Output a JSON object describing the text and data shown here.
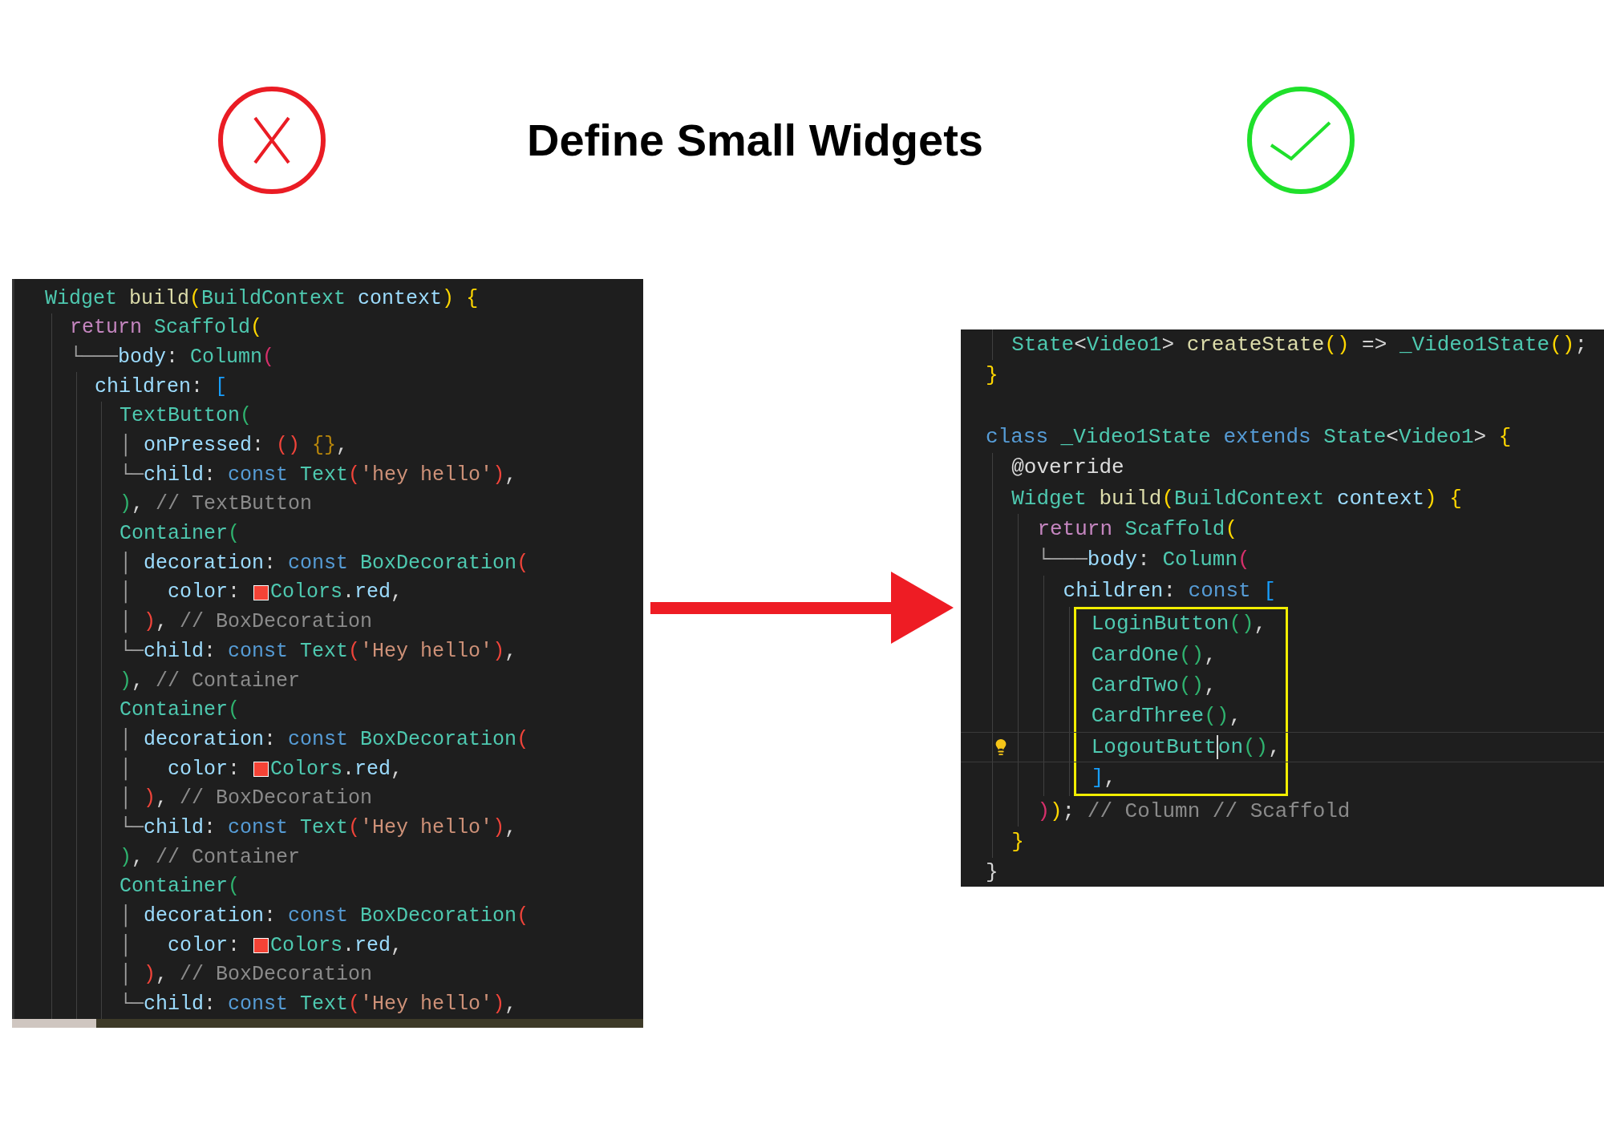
{
  "header": {
    "title": "Define Small Widgets"
  },
  "before_code": {
    "lines": [
      {
        "tokens": [
          {
            "kind": "type",
            "text": "Widget"
          },
          {
            "kind": "function",
            "text": " build"
          },
          {
            "kind": "b-gold",
            "text": "("
          },
          {
            "kind": "type",
            "text": "BuildContext"
          },
          {
            "kind": "variable",
            "text": " context"
          },
          {
            "kind": "b-gold",
            "text": ")"
          },
          {
            "kind": "b-gold",
            "text": " {"
          }
        ],
        "children": [
          {
            "tokens": [
              {
                "kind": "control",
                "text": "return"
              },
              {
                "kind": "type",
                "text": " Scaffold"
              },
              {
                "kind": "b-gold",
                "text": "("
              }
            ]
          },
          {
            "tokens": [
              {
                "kind": "guide",
                "text": "└───"
              },
              {
                "kind": "variable",
                "text": "body"
              },
              {
                "kind": "punct",
                "text": ": "
              },
              {
                "kind": "type",
                "text": "Column"
              },
              {
                "kind": "b-pink",
                "text": "("
              }
            ],
            "children": [
              {
                "tokens": [
                  {
                    "kind": "variable",
                    "text": "children"
                  },
                  {
                    "kind": "punct",
                    "text": ": "
                  },
                  {
                    "kind": "b-blue",
                    "text": "["
                  }
                ],
                "children": [
                  {
                    "tokens": [
                      {
                        "kind": "type",
                        "text": "TextButton"
                      },
                      {
                        "kind": "b-green",
                        "text": "("
                      }
                    ]
                  },
                  {
                    "tokens": [
                      {
                        "kind": "guide",
                        "text": "│ "
                      },
                      {
                        "kind": "variable",
                        "text": "onPressed"
                      },
                      {
                        "kind": "punct",
                        "text": ": "
                      },
                      {
                        "kind": "b-red",
                        "text": "()"
                      },
                      {
                        "kind": "b-brown",
                        "text": " {}"
                      },
                      {
                        "kind": "punct",
                        "text": ","
                      }
                    ]
                  },
                  {
                    "tokens": [
                      {
                        "kind": "guide",
                        "text": "└─"
                      },
                      {
                        "kind": "variable",
                        "text": "child"
                      },
                      {
                        "kind": "punct",
                        "text": ": "
                      },
                      {
                        "kind": "keyword",
                        "text": "const"
                      },
                      {
                        "kind": "type",
                        "text": " Text"
                      },
                      {
                        "kind": "b-red",
                        "text": "("
                      },
                      {
                        "kind": "string",
                        "text": "'hey hello'"
                      },
                      {
                        "kind": "b-red",
                        "text": ")"
                      },
                      {
                        "kind": "punct",
                        "text": ","
                      }
                    ]
                  },
                  {
                    "tokens": [
                      {
                        "kind": "b-green",
                        "text": ")"
                      },
                      {
                        "kind": "punct",
                        "text": ","
                      },
                      {
                        "kind": "comment",
                        "text": " // TextButton"
                      }
                    ]
                  },
                  {
                    "tokens": [
                      {
                        "kind": "type",
                        "text": "Container"
                      },
                      {
                        "kind": "b-green",
                        "text": "("
                      }
                    ]
                  },
                  {
                    "tokens": [
                      {
                        "kind": "guide",
                        "text": "│ "
                      },
                      {
                        "kind": "variable",
                        "text": "decoration"
                      },
                      {
                        "kind": "punct",
                        "text": ": "
                      },
                      {
                        "kind": "keyword",
                        "text": "const"
                      },
                      {
                        "kind": "type",
                        "text": " BoxDecoration"
                      },
                      {
                        "kind": "b-red",
                        "text": "("
                      }
                    ]
                  },
                  {
                    "tokens": [
                      {
                        "kind": "guide",
                        "text": "│   "
                      },
                      {
                        "kind": "variable",
                        "text": "color"
                      },
                      {
                        "kind": "punct",
                        "text": ": "
                      },
                      {
                        "kind": "swatch",
                        "color": "#f44336"
                      },
                      {
                        "kind": "type",
                        "text": "Colors"
                      },
                      {
                        "kind": "punct",
                        "text": "."
                      },
                      {
                        "kind": "variable",
                        "text": "red"
                      },
                      {
                        "kind": "punct",
                        "text": ","
                      }
                    ]
                  },
                  {
                    "tokens": [
                      {
                        "kind": "guide",
                        "text": "│ "
                      },
                      {
                        "kind": "b-red",
                        "text": ")"
                      },
                      {
                        "kind": "punct",
                        "text": ","
                      },
                      {
                        "kind": "comment",
                        "text": " // BoxDecoration"
                      }
                    ]
                  },
                  {
                    "tokens": [
                      {
                        "kind": "guide",
                        "text": "└─"
                      },
                      {
                        "kind": "variable",
                        "text": "child"
                      },
                      {
                        "kind": "punct",
                        "text": ": "
                      },
                      {
                        "kind": "keyword",
                        "text": "const"
                      },
                      {
                        "kind": "type",
                        "text": " Text"
                      },
                      {
                        "kind": "b-red",
                        "text": "("
                      },
                      {
                        "kind": "string",
                        "text": "'Hey hello'"
                      },
                      {
                        "kind": "b-red",
                        "text": ")"
                      },
                      {
                        "kind": "punct",
                        "text": ","
                      }
                    ]
                  },
                  {
                    "tokens": [
                      {
                        "kind": "b-green",
                        "text": ")"
                      },
                      {
                        "kind": "punct",
                        "text": ","
                      },
                      {
                        "kind": "comment",
                        "text": " // Container"
                      }
                    ]
                  },
                  {
                    "tokens": [
                      {
                        "kind": "type",
                        "text": "Container"
                      },
                      {
                        "kind": "b-green",
                        "text": "("
                      }
                    ]
                  },
                  {
                    "tokens": [
                      {
                        "kind": "guide",
                        "text": "│ "
                      },
                      {
                        "kind": "variable",
                        "text": "decoration"
                      },
                      {
                        "kind": "punct",
                        "text": ": "
                      },
                      {
                        "kind": "keyword",
                        "text": "const"
                      },
                      {
                        "kind": "type",
                        "text": " BoxDecoration"
                      },
                      {
                        "kind": "b-red",
                        "text": "("
                      }
                    ]
                  },
                  {
                    "tokens": [
                      {
                        "kind": "guide",
                        "text": "│   "
                      },
                      {
                        "kind": "variable",
                        "text": "color"
                      },
                      {
                        "kind": "punct",
                        "text": ": "
                      },
                      {
                        "kind": "swatch",
                        "color": "#f44336"
                      },
                      {
                        "kind": "type",
                        "text": "Colors"
                      },
                      {
                        "kind": "punct",
                        "text": "."
                      },
                      {
                        "kind": "variable",
                        "text": "red"
                      },
                      {
                        "kind": "punct",
                        "text": ","
                      }
                    ]
                  },
                  {
                    "tokens": [
                      {
                        "kind": "guide",
                        "text": "│ "
                      },
                      {
                        "kind": "b-red",
                        "text": ")"
                      },
                      {
                        "kind": "punct",
                        "text": ","
                      },
                      {
                        "kind": "comment",
                        "text": " // BoxDecoration"
                      }
                    ]
                  },
                  {
                    "tokens": [
                      {
                        "kind": "guide",
                        "text": "└─"
                      },
                      {
                        "kind": "variable",
                        "text": "child"
                      },
                      {
                        "kind": "punct",
                        "text": ": "
                      },
                      {
                        "kind": "keyword",
                        "text": "const"
                      },
                      {
                        "kind": "type",
                        "text": " Text"
                      },
                      {
                        "kind": "b-red",
                        "text": "("
                      },
                      {
                        "kind": "string",
                        "text": "'Hey hello'"
                      },
                      {
                        "kind": "b-red",
                        "text": ")"
                      },
                      {
                        "kind": "punct",
                        "text": ","
                      }
                    ]
                  },
                  {
                    "tokens": [
                      {
                        "kind": "b-green",
                        "text": ")"
                      },
                      {
                        "kind": "punct",
                        "text": ","
                      },
                      {
                        "kind": "comment",
                        "text": " // Container"
                      }
                    ]
                  },
                  {
                    "tokens": [
                      {
                        "kind": "type",
                        "text": "Container"
                      },
                      {
                        "kind": "b-green",
                        "text": "("
                      }
                    ]
                  },
                  {
                    "tokens": [
                      {
                        "kind": "guide",
                        "text": "│ "
                      },
                      {
                        "kind": "variable",
                        "text": "decoration"
                      },
                      {
                        "kind": "punct",
                        "text": ": "
                      },
                      {
                        "kind": "keyword",
                        "text": "const"
                      },
                      {
                        "kind": "type",
                        "text": " BoxDecoration"
                      },
                      {
                        "kind": "b-red",
                        "text": "("
                      }
                    ]
                  },
                  {
                    "tokens": [
                      {
                        "kind": "guide",
                        "text": "│   "
                      },
                      {
                        "kind": "variable",
                        "text": "color"
                      },
                      {
                        "kind": "punct",
                        "text": ": "
                      },
                      {
                        "kind": "swatch",
                        "color": "#f44336"
                      },
                      {
                        "kind": "type",
                        "text": "Colors"
                      },
                      {
                        "kind": "punct",
                        "text": "."
                      },
                      {
                        "kind": "variable",
                        "text": "red"
                      },
                      {
                        "kind": "punct",
                        "text": ","
                      }
                    ]
                  },
                  {
                    "tokens": [
                      {
                        "kind": "guide",
                        "text": "│ "
                      },
                      {
                        "kind": "b-red",
                        "text": ")"
                      },
                      {
                        "kind": "punct",
                        "text": ","
                      },
                      {
                        "kind": "comment",
                        "text": " // BoxDecoration"
                      }
                    ]
                  },
                  {
                    "tokens": [
                      {
                        "kind": "guide",
                        "text": "└─"
                      },
                      {
                        "kind": "variable",
                        "text": "child"
                      },
                      {
                        "kind": "punct",
                        "text": ": "
                      },
                      {
                        "kind": "keyword",
                        "text": "const"
                      },
                      {
                        "kind": "type",
                        "text": " Text"
                      },
                      {
                        "kind": "b-red",
                        "text": "("
                      },
                      {
                        "kind": "string",
                        "text": "'Hey hello'"
                      },
                      {
                        "kind": "b-red",
                        "text": ")"
                      },
                      {
                        "kind": "punct",
                        "text": ","
                      }
                    ]
                  }
                ]
              }
            ]
          }
        ]
      }
    ]
  },
  "after_code": {
    "lines": [
      {
        "children": [
          {
            "tokens": [
              {
                "kind": "type",
                "text": "State"
              },
              {
                "kind": "punct",
                "text": "<"
              },
              {
                "kind": "type",
                "text": "Video1"
              },
              {
                "kind": "punct",
                "text": ">"
              },
              {
                "kind": "function",
                "text": " createState"
              },
              {
                "kind": "b-gold",
                "text": "()"
              },
              {
                "kind": "punct",
                "text": " =>"
              },
              {
                "kind": "type",
                "text": " _Video1State"
              },
              {
                "kind": "b-gold",
                "text": "()"
              },
              {
                "kind": "punct",
                "text": ";"
              }
            ]
          }
        ]
      },
      {
        "tokens": [
          {
            "kind": "b-gold",
            "text": "}"
          }
        ]
      },
      {
        "kind": "blank"
      },
      {
        "tokens": [
          {
            "kind": "keyword",
            "text": "class"
          },
          {
            "kind": "type",
            "text": " _Video1State"
          },
          {
            "kind": "keyword",
            "text": " extends"
          },
          {
            "kind": "type",
            "text": " State"
          },
          {
            "kind": "punct",
            "text": "<"
          },
          {
            "kind": "type",
            "text": "Video1"
          },
          {
            "kind": "punct",
            "text": ">"
          },
          {
            "kind": "b-gold",
            "text": " {"
          }
        ],
        "children": [
          {
            "tokens": [
              {
                "kind": "decorator",
                "text": "@override"
              }
            ]
          },
          {
            "tokens": [
              {
                "kind": "type",
                "text": "Widget"
              },
              {
                "kind": "function",
                "text": " build"
              },
              {
                "kind": "b-gold",
                "text": "("
              },
              {
                "kind": "type",
                "text": "BuildContext"
              },
              {
                "kind": "variable",
                "text": " context"
              },
              {
                "kind": "b-gold",
                "text": ")"
              },
              {
                "kind": "b-gold",
                "text": " {"
              }
            ],
            "children": [
              {
                "tokens": [
                  {
                    "kind": "control",
                    "text": "return"
                  },
                  {
                    "kind": "type",
                    "text": " Scaffold"
                  },
                  {
                    "kind": "b-gold",
                    "text": "("
                  }
                ]
              },
              {
                "tokens": [
                  {
                    "kind": "guide",
                    "text": "└───"
                  },
                  {
                    "kind": "variable",
                    "text": "body"
                  },
                  {
                    "kind": "punct",
                    "text": ": "
                  },
                  {
                    "kind": "type",
                    "text": "Column"
                  },
                  {
                    "kind": "b-pink",
                    "text": "("
                  }
                ],
                "children": [
                  {
                    "tokens": [
                      {
                        "kind": "variable",
                        "text": "children"
                      },
                      {
                        "kind": "punct",
                        "text": ": "
                      },
                      {
                        "kind": "keyword",
                        "text": "const"
                      },
                      {
                        "kind": "b-blue",
                        "text": " ["
                      }
                    ],
                    "highlighted": true,
                    "children": [
                      {
                        "tokens": [
                          {
                            "kind": "type",
                            "text": "LoginButton"
                          },
                          {
                            "kind": "b-green",
                            "text": "()"
                          },
                          {
                            "kind": "punct",
                            "text": ","
                          }
                        ]
                      },
                      {
                        "tokens": [
                          {
                            "kind": "type",
                            "text": "CardOne"
                          },
                          {
                            "kind": "b-green",
                            "text": "()"
                          },
                          {
                            "kind": "punct",
                            "text": ","
                          }
                        ]
                      },
                      {
                        "tokens": [
                          {
                            "kind": "type",
                            "text": "CardTwo"
                          },
                          {
                            "kind": "b-green",
                            "text": "()"
                          },
                          {
                            "kind": "punct",
                            "text": ","
                          }
                        ]
                      },
                      {
                        "tokens": [
                          {
                            "kind": "type",
                            "text": "CardThree"
                          },
                          {
                            "kind": "b-green",
                            "text": "()"
                          },
                          {
                            "kind": "punct",
                            "text": ","
                          }
                        ]
                      },
                      {
                        "tokens": [
                          {
                            "kind": "type",
                            "text": "LogoutButt"
                          },
                          {
                            "kind": "cursor"
                          },
                          {
                            "kind": "type",
                            "text": "on"
                          },
                          {
                            "kind": "b-green",
                            "text": "()"
                          },
                          {
                            "kind": "punct",
                            "text": ","
                          }
                        ],
                        "current": true,
                        "lightbulb": true
                      }
                    ],
                    "closing": {
                      "tokens": [
                        {
                          "kind": "b-blue",
                          "text": "]"
                        },
                        {
                          "kind": "punct",
                          "text": ","
                        }
                      ]
                    }
                  }
                ]
              },
              {
                "tokens": [
                  {
                    "kind": "b-pink",
                    "text": ")"
                  },
                  {
                    "kind": "b-gold",
                    "text": ")"
                  },
                  {
                    "kind": "punct",
                    "text": ";"
                  },
                  {
                    "kind": "comment",
                    "text": " // Column // Scaffold"
                  }
                ]
              }
            ]
          },
          {
            "tokens": [
              {
                "kind": "b-gold",
                "text": "}"
              }
            ]
          }
        ]
      },
      {
        "tokens": [
          {
            "kind": "punct",
            "text": "}"
          }
        ]
      }
    ]
  }
}
